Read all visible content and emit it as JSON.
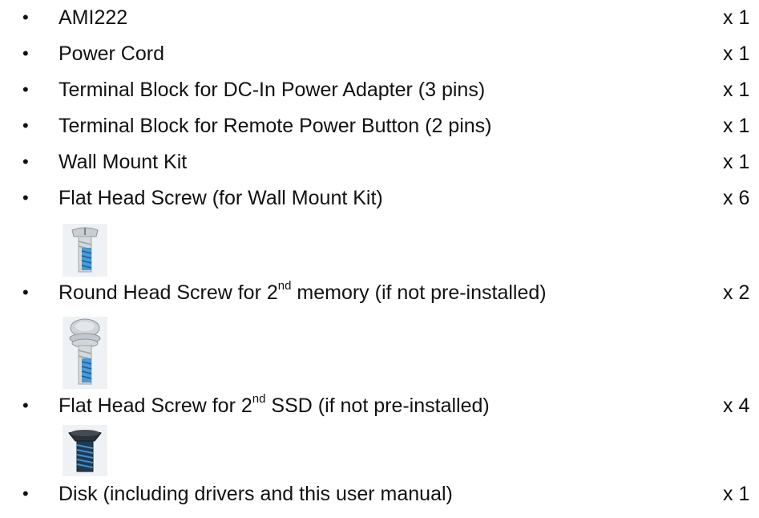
{
  "items": [
    {
      "name": "AMI222",
      "qty": "x 1"
    },
    {
      "name": "Power Cord",
      "qty": "x 1"
    },
    {
      "name": "Terminal Block for DC-In Power Adapter (3 pins)",
      "qty": "x 1"
    },
    {
      "name": "Terminal Block for Remote Power Button (2 pins)",
      "qty": "x 1"
    },
    {
      "name": "Wall Mount Kit",
      "qty": "x 1"
    },
    {
      "name": "Flat Head Screw (for Wall Mount Kit)",
      "qty": "x 6"
    },
    {
      "name_pre": "Round Head Screw for 2",
      "name_sup": "nd",
      "name_post": " memory (if not pre-installed)",
      "qty": "x 2"
    },
    {
      "name_pre": "Flat Head Screw for 2",
      "name_sup": "nd",
      "name_post": " SSD (if not pre-installed)",
      "qty": "x 4"
    },
    {
      "name": "Disk (including drivers and this user manual)",
      "qty": "x 1"
    }
  ],
  "bullet": "•",
  "icons": {
    "flat_head_screw_wall": "flat-head-screw-silver-blue-thread",
    "round_head_screw": "round-head-screw-silver-blue-thread",
    "flat_head_screw_ssd": "flat-head-screw-black-blue-thread"
  }
}
